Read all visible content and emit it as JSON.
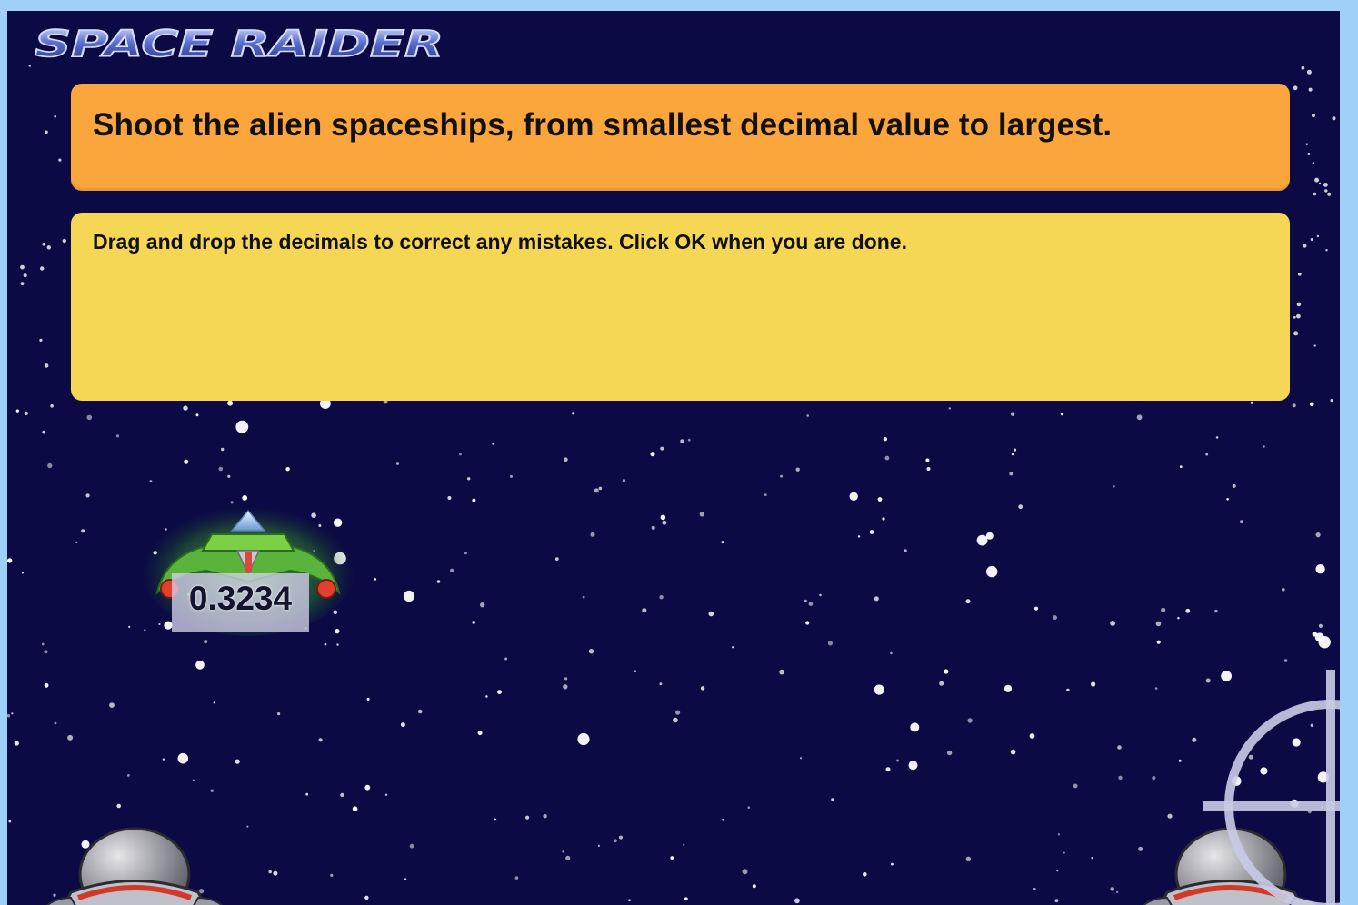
{
  "game": {
    "title": "SPACE RAIDER",
    "instruction": "Shoot the alien spaceships, from smallest decimal value to largest.",
    "feedback": "Drag and drop the decimals to correct any mistakes. Click OK when you are done."
  },
  "aliens": [
    {
      "value": "0.3234"
    }
  ],
  "colors": {
    "background": "#0b0a45",
    "frame": "#9fd0f7",
    "instruction_panel": "#fba53d",
    "feedback_panel": "#f6d655",
    "alien_body": "#4caf2f",
    "logo_fill": "#3d4fa8"
  },
  "icons": {
    "alien": "alien-spaceship-icon",
    "cannon": "cannon-dome-icon",
    "crosshair": "crosshair-icon"
  }
}
